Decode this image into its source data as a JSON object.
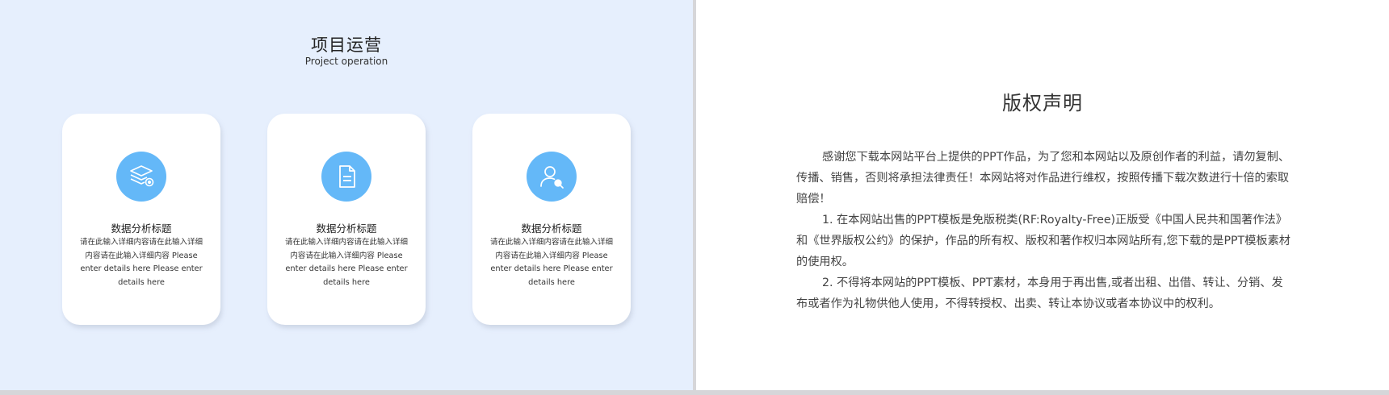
{
  "left_slide": {
    "title": "项目运营",
    "subtitle": "Project operation",
    "accent_color": "#64b8f8",
    "cards": [
      {
        "icon": "layers-location-icon",
        "title": "数据分析标题",
        "desc_zh": "请在此输入详细内容请在此输入详细内容请在此输入详细内容",
        "desc_en": "Please enter details here Please enter details here"
      },
      {
        "icon": "document-icon",
        "title": "数据分析标题",
        "desc_zh": "请在此输入详细内容请在此输入详细内容请在此输入详细内容",
        "desc_en": "Please enter details here Please enter details here"
      },
      {
        "icon": "user-search-icon",
        "title": "数据分析标题",
        "desc_zh": "请在此输入详细内容请在此输入详细内容请在此输入详细内容",
        "desc_en": "Please enter details here Please enter details here"
      }
    ]
  },
  "right_slide": {
    "title": "版权声明",
    "paragraphs": [
      "感谢您下载本网站平台上提供的PPT作品，为了您和本网站以及原创作者的利益，请勿复制、传播、销售，否则将承担法律责任！本网站将对作品进行维权，按照传播下载次数进行十倍的索取赔偿！",
      "1. 在本网站出售的PPT模板是免版税类(RF:Royalty-Free)正版受《中国人民共和国著作法》和《世界版权公约》的保护，作品的所有权、版权和著作权归本网站所有,您下载的是PPT模板素材的使用权。",
      "2. 不得将本网站的PPT模板、PPT素材，本身用于再出售,或者出租、出借、转让、分销、发布或者作为礼物供他人使用，不得转授权、出卖、转让本协议或者本协议中的权利。"
    ]
  }
}
